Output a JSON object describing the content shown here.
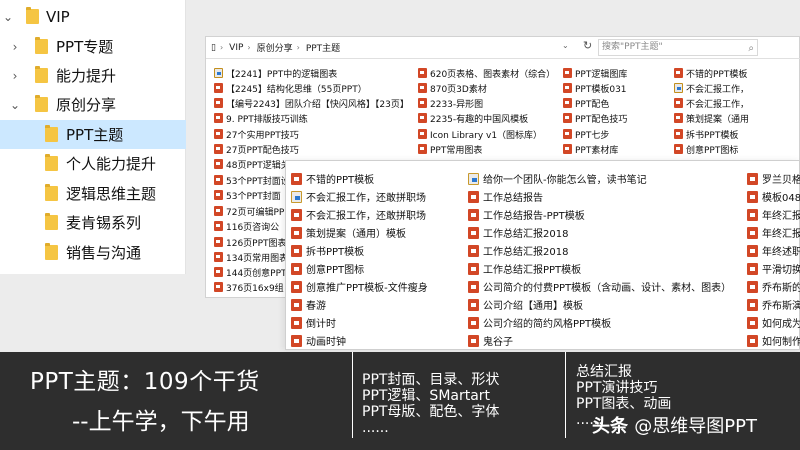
{
  "tree": {
    "items": [
      {
        "label": "VIP",
        "expanded": true
      },
      {
        "label": "PPT专题",
        "expanded": false
      },
      {
        "label": "能力提升",
        "expanded": false
      },
      {
        "label": "原创分享",
        "expanded": true
      },
      {
        "label": "PPT主题",
        "selected": true
      },
      {
        "label": "个人能力提升"
      },
      {
        "label": "逻辑思维主题"
      },
      {
        "label": "麦肯锡系列"
      },
      {
        "label": "销售与沟通"
      }
    ]
  },
  "explorer": {
    "breadcrumb": [
      "VIP",
      "原创分享",
      "PPT主题"
    ],
    "search_placeholder": "搜索\"PPT主题\"",
    "columns": [
      [
        "【2241】PPT中的逻辑图表",
        "【2245】结构化思维（55页PPT）",
        "【编号2243】团队介绍【快闪风格】【23页】",
        "9. PPT排版技巧训练",
        "27个实用PPT技巧",
        "27页PPT配色技巧",
        "48页PPT逻辑关",
        "53个PPT封面设",
        "53个PPT封面",
        "72页可编辑PP",
        "116页咨询公",
        "126页PPT图表",
        "134页常用图表",
        "144页创意PPT",
        "376页16x9组"
      ],
      [
        "620页表格、图表素材（综合）",
        "870页3D素材",
        "2233-异形图",
        "2235-有趣的中国风模板",
        "Icon Library v1（图标库）",
        "PPT常用图表"
      ],
      [
        "PPT逻辑图库",
        "PPT模板031",
        "PPT配色",
        "PPT配色技巧",
        "PPT七步",
        "PPT素材库"
      ],
      [
        "不错的PPT模板",
        "不会汇报工作，",
        "不会汇报工作，",
        "策划提案（通用",
        "拆书PPT模板",
        "创意PPT图标"
      ]
    ]
  },
  "explorer2": {
    "columns": [
      [
        "不错的PPT模板",
        "不会汇报工作，还敢拼职场",
        "不会汇报工作，还敢拼职场",
        "策划提案（通用）模板",
        "拆书PPT模板",
        "创意PPT图标",
        "创意推广PPT模板-文件瘦身",
        "春游",
        "倒计时",
        "动画时钟"
      ],
      [
        "给你一个团队-你能怎么管，读书笔记",
        "工作总结报告",
        "工作总结报告-PPT模板",
        "工作总结汇报2018",
        "工作总结汇报2018",
        "工作总结汇报PPT模板",
        "公司简介的付费PPT模板（含动画、设计、素材、图表）",
        "公司介绍【通用】模板",
        "公司介绍的简约风格PPT模板",
        "鬼谷子"
      ],
      [
        "罗兰贝格",
        "模板048",
        "年终汇报",
        "年终汇报",
        "年终述职",
        "平滑切换",
        "乔布斯的",
        "乔布斯演",
        "如何成为",
        "如何制作"
      ]
    ]
  },
  "banner": {
    "title": "PPT主题：109个干货",
    "subtitle": "--上午学，下午用",
    "col1": [
      "PPT封面、目录、形状",
      "PPT逻辑、SMartart",
      "PPT母版、配色、字体",
      "......"
    ],
    "col2": [
      "总结汇报",
      "PPT演讲技巧",
      "PPT图表、动画",
      "......"
    ],
    "watermark_brand": "头条",
    "watermark_handle": "@思维导图PPT"
  }
}
